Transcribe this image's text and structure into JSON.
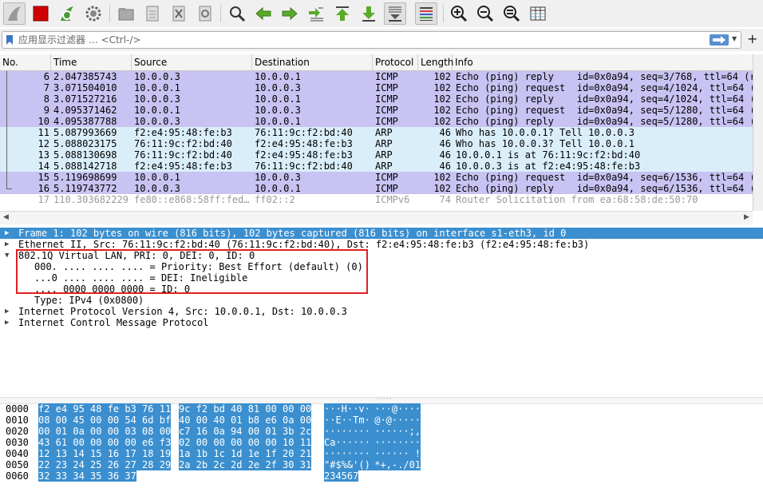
{
  "toolbar": {
    "icons": [
      "shark-fin-icon",
      "stop-icon",
      "restart-icon",
      "capture-options-icon",
      "open-file-icon",
      "file-icon",
      "close-file-icon",
      "reload-icon",
      "find-icon",
      "back-icon",
      "forward-icon",
      "go-to-packet-icon",
      "first-packet-icon",
      "last-packet-icon",
      "autoscroll-icon",
      "colorize-icon",
      "zoom-in-icon",
      "zoom-out-icon",
      "zoom-normal-icon",
      "resize-columns-icon"
    ]
  },
  "filter": {
    "placeholder": "应用显示过滤器 … <Ctrl-/>",
    "apply_icon": "arrow-right-icon",
    "add_label": "+"
  },
  "packet_list": {
    "columns": [
      "No.",
      "Time",
      "Source",
      "Destination",
      "Protocol",
      "Length",
      "Info"
    ],
    "rows": [
      {
        "no": "6",
        "time": "2.047385743",
        "src": "10.0.0.3",
        "dst": "10.0.0.1",
        "proto": "ICMP",
        "len": "102",
        "info": "Echo (ping) reply    id=0x0a94, seq=3/768, ttl=64 (r",
        "color": "#c8c3f2"
      },
      {
        "no": "7",
        "time": "3.071504010",
        "src": "10.0.0.1",
        "dst": "10.0.0.3",
        "proto": "ICMP",
        "len": "102",
        "info": "Echo (ping) request  id=0x0a94, seq=4/1024, ttl=64 (",
        "color": "#c8c3f2"
      },
      {
        "no": "8",
        "time": "3.071527216",
        "src": "10.0.0.3",
        "dst": "10.0.0.1",
        "proto": "ICMP",
        "len": "102",
        "info": "Echo (ping) reply    id=0x0a94, seq=4/1024, ttl=64 (",
        "color": "#c8c3f2"
      },
      {
        "no": "9",
        "time": "4.095371462",
        "src": "10.0.0.1",
        "dst": "10.0.0.3",
        "proto": "ICMP",
        "len": "102",
        "info": "Echo (ping) request  id=0x0a94, seq=5/1280, ttl=64 (",
        "color": "#c8c3f2"
      },
      {
        "no": "10",
        "time": "4.095387788",
        "src": "10.0.0.3",
        "dst": "10.0.0.1",
        "proto": "ICMP",
        "len": "102",
        "info": "Echo (ping) reply    id=0x0a94, seq=5/1280, ttl=64 (",
        "color": "#c8c3f2"
      },
      {
        "no": "11",
        "time": "5.087993669",
        "src": "f2:e4:95:48:fe:b3",
        "dst": "76:11:9c:f2:bd:40",
        "proto": "ARP",
        "len": "46",
        "info": "Who has 10.0.0.1? Tell 10.0.0.3",
        "color": "#daeefa"
      },
      {
        "no": "12",
        "time": "5.088023175",
        "src": "76:11:9c:f2:bd:40",
        "dst": "f2:e4:95:48:fe:b3",
        "proto": "ARP",
        "len": "46",
        "info": "Who has 10.0.0.3? Tell 10.0.0.1",
        "color": "#daeefa"
      },
      {
        "no": "13",
        "time": "5.088130698",
        "src": "76:11:9c:f2:bd:40",
        "dst": "f2:e4:95:48:fe:b3",
        "proto": "ARP",
        "len": "46",
        "info": "10.0.0.1 is at 76:11:9c:f2:bd:40",
        "color": "#daeefa"
      },
      {
        "no": "14",
        "time": "5.088142718",
        "src": "f2:e4:95:48:fe:b3",
        "dst": "76:11:9c:f2:bd:40",
        "proto": "ARP",
        "len": "46",
        "info": "10.0.0.3 is at f2:e4:95:48:fe:b3",
        "color": "#daeefa"
      },
      {
        "no": "15",
        "time": "5.119698699",
        "src": "10.0.0.1",
        "dst": "10.0.0.3",
        "proto": "ICMP",
        "len": "102",
        "info": "Echo (ping) request  id=0x0a94, seq=6/1536, ttl=64 (",
        "color": "#c8c3f2"
      },
      {
        "no": "16",
        "time": "5.119743772",
        "src": "10.0.0.3",
        "dst": "10.0.0.1",
        "proto": "ICMP",
        "len": "102",
        "info": "Echo (ping) reply    id=0x0a94, seq=6/1536, ttl=64 (",
        "color": "#c8c3f2"
      },
      {
        "no": "17",
        "time": "110.303682229",
        "src": "fe80::e868:58ff:fed…",
        "dst": "ff02::2",
        "proto": "ICMPv6",
        "len": "74",
        "info": "Router Solicitation from ea:68:58:de:50:70",
        "color": "#ffffff",
        "dim": true
      }
    ]
  },
  "detail": {
    "rows": [
      {
        "text": "Frame 1: 102 bytes on wire (816 bits), 102 bytes captured (816 bits) on interface s1-eth3, id 0",
        "expander": "▶",
        "selected": true
      },
      {
        "text": "Ethernet II, Src: 76:11:9c:f2:bd:40 (76:11:9c:f2:bd:40), Dst: f2:e4:95:48:fe:b3 (f2:e4:95:48:fe:b3)",
        "expander": "▶"
      },
      {
        "text": "802.1Q Virtual LAN, PRI: 0, DEI: 0, ID: 0",
        "expander": "▼"
      },
      {
        "text": "000. .... .... .... = Priority: Best Effort (default) (0)",
        "indent": true
      },
      {
        "text": "...0 .... .... .... = DEI: Ineligible",
        "indent": true
      },
      {
        "text": ".... 0000 0000 0000 = ID: 0",
        "indent": true
      },
      {
        "text": "Type: IPv4 (0x0800)",
        "indent": true
      },
      {
        "text": "Internet Protocol Version 4, Src: 10.0.0.1, Dst: 10.0.0.3",
        "expander": "▶"
      },
      {
        "text": "Internet Control Message Protocol",
        "expander": "▶"
      }
    ]
  },
  "bytes": {
    "rows": [
      {
        "offset": "0000",
        "hex1": "f2 e4 95 48 fe b3 76 11",
        "hex2": "9c f2 bd 40 81 00 00 00",
        "ascii1": "···H··v·",
        "ascii2": " ···@····"
      },
      {
        "offset": "0010",
        "hex1": "08 00 45 00 00 54 6d bf",
        "hex2": "40 00 40 01 b8 e6 0a 00",
        "ascii1": "··E··Tm·",
        "ascii2": " @·@·····"
      },
      {
        "offset": "0020",
        "hex1": "00 01 0a 00 00 03 08 00",
        "hex2": "c7 16 0a 94 00 01 3b 2c",
        "ascii1": "········",
        "ascii2": " ······;,"
      },
      {
        "offset": "0030",
        "hex1": "43 61 00 00 00 00 e6 f3",
        "hex2": "02 00 00 00 00 00 10 11",
        "ascii1": "Ca······",
        "ascii2": " ········"
      },
      {
        "offset": "0040",
        "hex1": "12 13 14 15 16 17 18 19",
        "hex2": "1a 1b 1c 1d 1e 1f 20 21",
        "ascii1": "········",
        "ascii2": " ······ !"
      },
      {
        "offset": "0050",
        "hex1": "22 23 24 25 26 27 28 29",
        "hex2": "2a 2b 2c 2d 2e 2f 30 31",
        "ascii1": "\"#$%&'()",
        "ascii2": " *+,-./01"
      },
      {
        "offset": "0060",
        "hex1": "32 33 34 35 36 37",
        "hex2": "",
        "ascii1": "234567",
        "ascii2": ""
      }
    ]
  },
  "colors": {
    "icmp_row": "#c8c3f2",
    "arp_row": "#daeefa",
    "selection": "#3b8fcf",
    "highlight_box": "#e02020"
  }
}
